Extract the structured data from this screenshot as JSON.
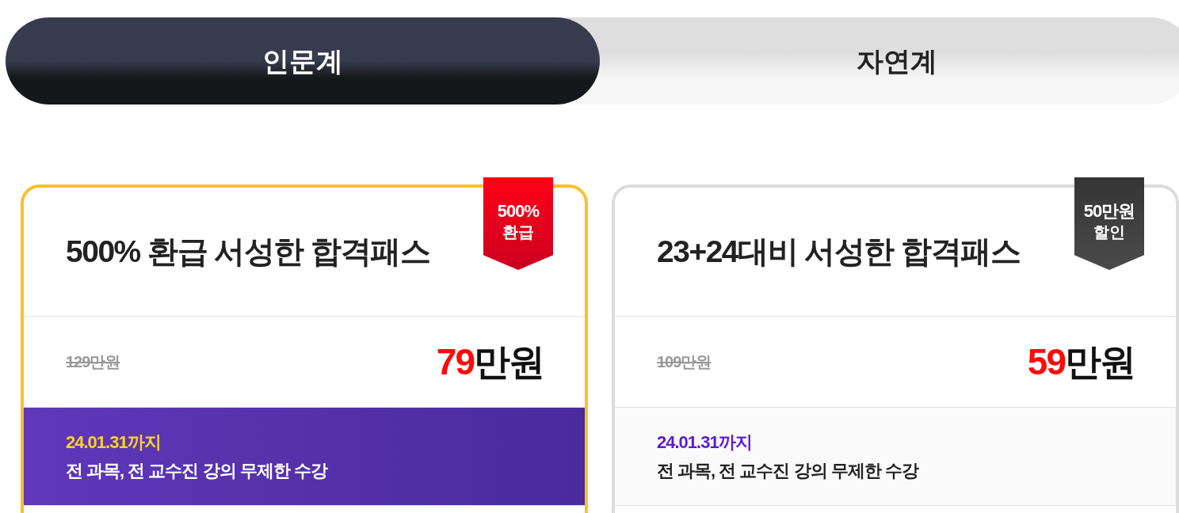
{
  "tabs": [
    {
      "label": "인문계",
      "selected": true
    },
    {
      "label": "자연계",
      "selected": false
    }
  ],
  "cards": [
    {
      "featured": true,
      "badge": {
        "value": "500%",
        "label": "환급"
      },
      "title": "500% 환급 서성한 합격패스",
      "original_price": "129만원",
      "price": {
        "amount": "79",
        "unit": "만원"
      },
      "promo": {
        "deadline": "24.01.31까지",
        "description": "전 과목, 전 교수진 강의 무제한 수강"
      }
    },
    {
      "featured": false,
      "badge": {
        "value": "50만원",
        "label": "할인"
      },
      "title": "23+24대비 서성한 합격패스",
      "original_price": "109만원",
      "price": {
        "amount": "59",
        "unit": "만원"
      },
      "promo": {
        "deadline": "24.01.31까지",
        "description": "전 과목, 전 교수진 강의 무제한 수강"
      }
    }
  ]
}
